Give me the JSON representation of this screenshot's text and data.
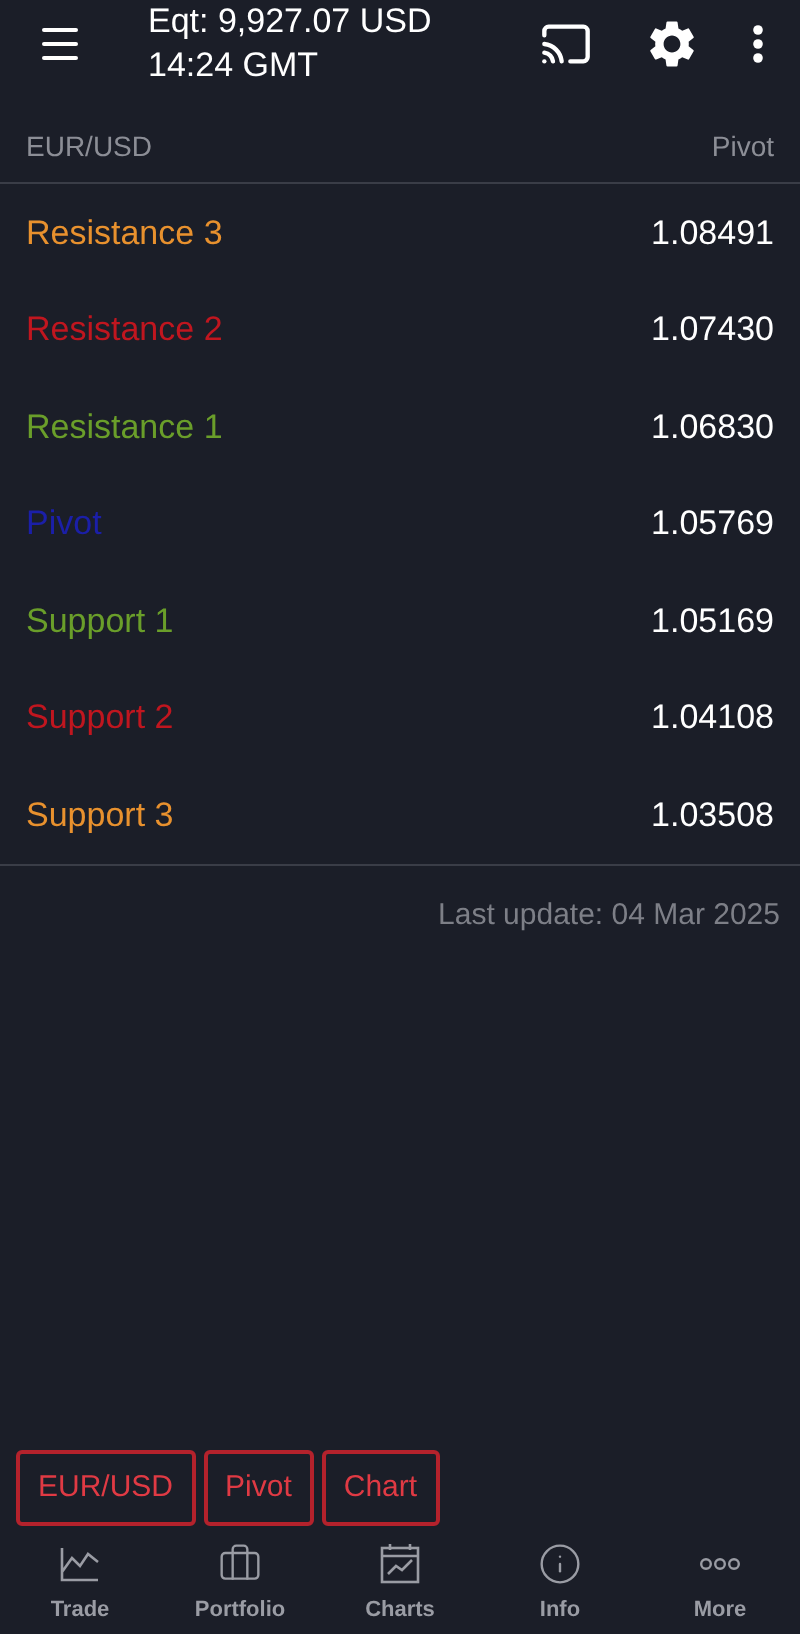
{
  "header": {
    "equity": "Eqt: 9,927.07 USD",
    "time": "14:24 GMT"
  },
  "table": {
    "columns": [
      "EUR/USD",
      "Pivot"
    ],
    "rows": [
      {
        "label": "Resistance 3",
        "value": "1.08491",
        "color": "#e8912e"
      },
      {
        "label": "Resistance 2",
        "value": "1.07430",
        "color": "#c0161f"
      },
      {
        "label": "Resistance 1",
        "value": "1.06830",
        "color": "#6a9e2a"
      },
      {
        "label": "Pivot",
        "value": "1.05769",
        "color": "#1b1fa8"
      },
      {
        "label": "Support 1",
        "value": "1.05169",
        "color": "#6a9e2a"
      },
      {
        "label": "Support 2",
        "value": "1.04108",
        "color": "#c0161f"
      },
      {
        "label": "Support 3",
        "value": "1.03508",
        "color": "#e8912e"
      }
    ]
  },
  "last_update": "Last update: 04 Mar 2025",
  "chips": [
    "EUR/USD",
    "Pivot",
    "Chart"
  ],
  "bottom_nav": [
    {
      "kind": "trade",
      "label": "Trade"
    },
    {
      "kind": "portfolio",
      "label": "Portfolio"
    },
    {
      "kind": "charts",
      "label": "Charts"
    },
    {
      "kind": "info",
      "label": "Info"
    },
    {
      "kind": "more",
      "label": "More"
    }
  ]
}
